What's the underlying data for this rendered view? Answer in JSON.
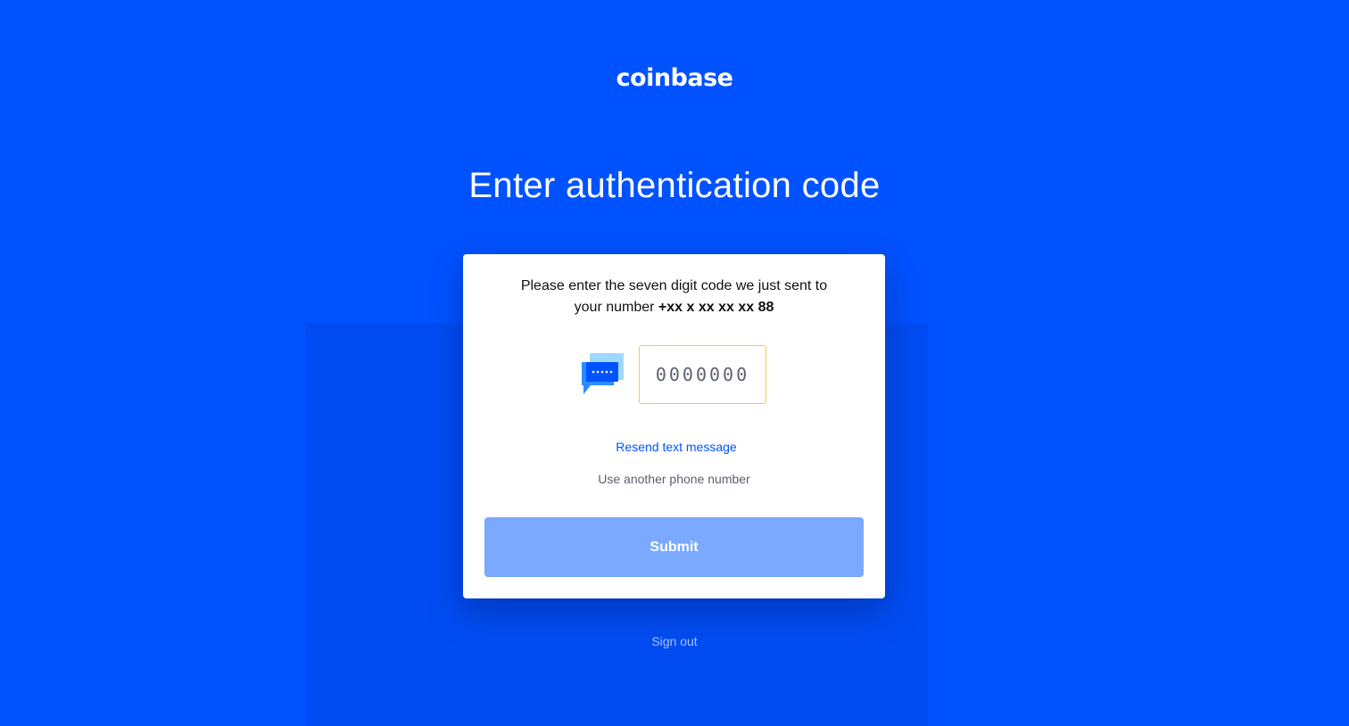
{
  "brand": {
    "logo_text": "coinbase"
  },
  "page": {
    "title": "Enter authentication code"
  },
  "card": {
    "instructions_line1": "Please enter the seven digit code we just sent to",
    "instructions_line2_prefix": "your number ",
    "phone_masked": "+xx x xx xx xx 88",
    "code_input": {
      "value": "",
      "placeholder": "0000000"
    },
    "chat_icon": "chat-bubble-icon",
    "resend_label": "Resend text message",
    "another_number_label": "Use another phone number",
    "submit_label": "Submit"
  },
  "footer": {
    "sign_out_label": "Sign out"
  },
  "colors": {
    "background": "#0052ff",
    "accent": "#0052ff",
    "submit_disabled": "#7aa9ff",
    "input_border_focus": "#f2c94c"
  }
}
